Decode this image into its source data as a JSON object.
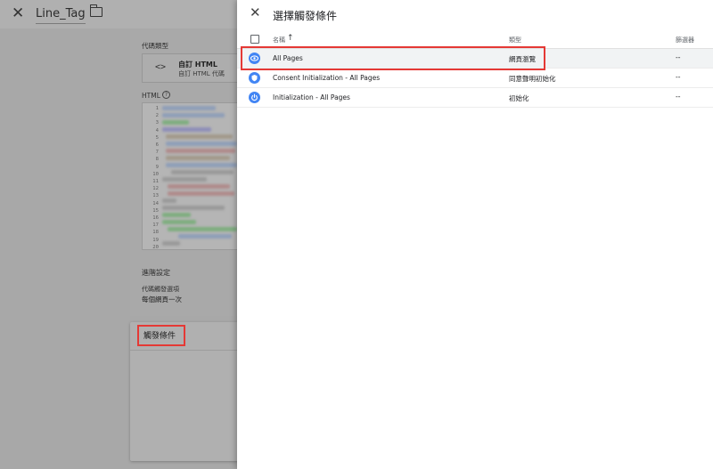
{
  "background_editor": {
    "title": "Line_Tag",
    "tag_type_label": "代碼類型",
    "tag_type_name": "自訂 HTML",
    "tag_type_subtitle": "自訂 HTML 代碼",
    "html_label": "HTML",
    "line_numbers": [
      "1",
      "2",
      "3",
      "4",
      "5",
      "6",
      "7",
      "8",
      "9",
      "10",
      "11",
      "12",
      "13",
      "14",
      "15",
      "16",
      "17",
      "18",
      "19",
      "20"
    ],
    "advanced_settings_label": "進階設定",
    "firing_options_label": "代碼觸發選項",
    "firing_options_value": "每個網頁一次",
    "triggering_title": "觸發條件"
  },
  "panel": {
    "title": "選擇觸發條件",
    "columns": {
      "name": "名稱",
      "type": "類型",
      "filter": "篩選器"
    },
    "rows": [
      {
        "name": "All Pages",
        "type": "網頁瀏覽",
        "filter": "--",
        "icon": "eye-icon"
      },
      {
        "name": "Consent Initialization - All Pages",
        "type": "同意聲明初始化",
        "filter": "--",
        "icon": "consent-icon"
      },
      {
        "name": "Initialization - All Pages",
        "type": "初始化",
        "filter": "--",
        "icon": "power-icon"
      }
    ]
  },
  "colors": {
    "highlight": "#e53935",
    "trigger_icon": "#4285f4",
    "overlay": "#a8a8a8"
  }
}
